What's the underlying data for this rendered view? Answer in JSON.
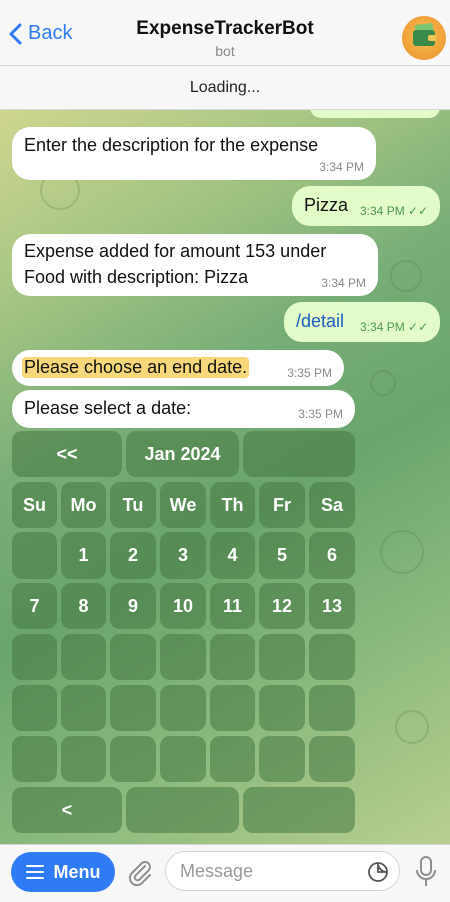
{
  "header": {
    "back_label": "Back",
    "title": "ExpenseTrackerBot",
    "subtitle": "bot",
    "status": "Loading..."
  },
  "messages": [
    {
      "text": "Enter the description for the expense",
      "time": "3:34 PM",
      "dir": "in"
    },
    {
      "text": "Pizza",
      "time": "3:34 PM",
      "dir": "out"
    },
    {
      "text_line1": "Expense added for amount 153 under",
      "text_line2": "Food with description: Pizza",
      "time": "3:34 PM",
      "dir": "in"
    },
    {
      "text": "/detail",
      "time": "3:34 PM",
      "dir": "out"
    },
    {
      "text": "Please choose an end date.",
      "time": "3:35 PM",
      "dir": "in"
    },
    {
      "text": "Please select a date:",
      "time": "3:35 PM",
      "dir": "in"
    }
  ],
  "keyboard": {
    "nav": [
      "<<",
      "Jan 2024",
      ""
    ],
    "weekdays": [
      "Su",
      "Mo",
      "Tu",
      "We",
      "Th",
      "Fr",
      "Sa"
    ],
    "week1": [
      "",
      "1",
      "2",
      "3",
      "4",
      "5",
      "6"
    ],
    "week2": [
      "7",
      "8",
      "9",
      "10",
      "11",
      "12",
      "13"
    ],
    "empty_rows": 3,
    "bottom": [
      "<",
      "",
      ""
    ]
  },
  "input": {
    "menu_label": "Menu",
    "placeholder": "Message"
  },
  "colors": {
    "accent": "#2f7bf5",
    "incoming_bubble": "#ffffff",
    "outgoing_bubble": "#e3fac9",
    "highlight": "#f6d77a"
  }
}
